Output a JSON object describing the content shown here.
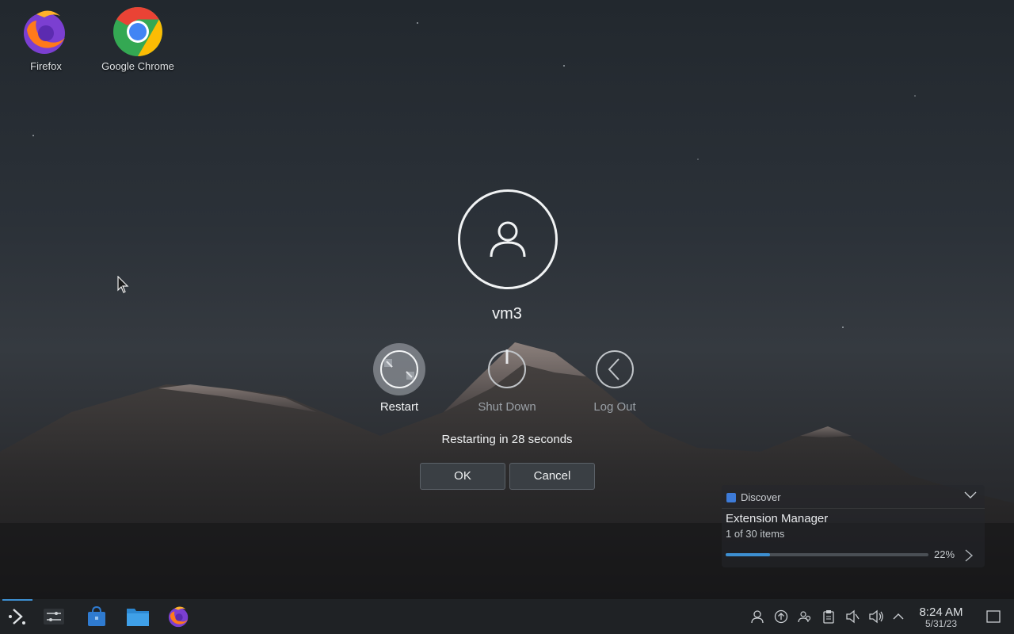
{
  "desktop": {
    "icons": [
      {
        "label": "Firefox"
      },
      {
        "label": "Google Chrome"
      }
    ]
  },
  "logout_dialog": {
    "username": "vm3",
    "actions": [
      {
        "label": "Restart",
        "icon": "restart-icon",
        "selected": true
      },
      {
        "label": "Shut Down",
        "icon": "power-icon",
        "selected": false
      },
      {
        "label": "Log Out",
        "icon": "back-arrow-icon",
        "selected": false
      }
    ],
    "countdown_text": "Restarting in 28 seconds",
    "ok_label": "OK",
    "cancel_label": "Cancel"
  },
  "notification": {
    "app_name": "Discover",
    "title": "Extension Manager",
    "subtitle": "1 of 30 items",
    "progress_percent": 22,
    "progress_label": "22%"
  },
  "taskbar": {
    "launchers": [
      "application-launcher-icon",
      "settings-icon",
      "discover-store-icon",
      "file-manager-icon",
      "firefox-icon"
    ],
    "tray_icons": [
      "user-icon",
      "update-icon",
      "users-icon",
      "clipboard-icon",
      "audio-muted-icon",
      "volume-icon",
      "expand-tray-icon"
    ],
    "clock": {
      "time": "8:24 AM",
      "date": "5/31/23"
    },
    "accent_color": "#3d8fd1"
  }
}
